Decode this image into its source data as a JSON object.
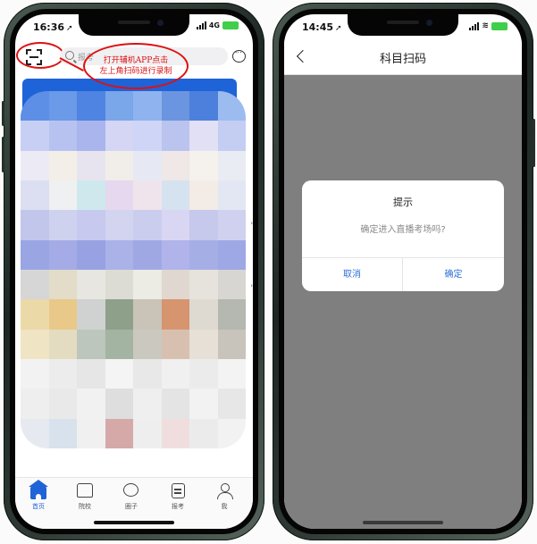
{
  "left_phone": {
    "status": {
      "time": "16:36",
      "network": "4G"
    },
    "search": {
      "placeholder": "报考"
    },
    "annotation": {
      "line1": "打开辅机APP点击",
      "line2": "左上角扫码进行录制"
    },
    "tabs": [
      {
        "label": "首页",
        "icon": "home-icon",
        "active": true
      },
      {
        "label": "院校",
        "icon": "college-icon",
        "active": false
      },
      {
        "label": "圈子",
        "icon": "chat-bubble-icon",
        "active": false
      },
      {
        "label": "报考",
        "icon": "document-icon",
        "active": false
      },
      {
        "label": "我",
        "icon": "user-icon",
        "active": false
      }
    ],
    "colors": {
      "accent": "#1f63d8",
      "annotation_red": "#d11111"
    }
  },
  "right_phone": {
    "status": {
      "time": "14:45"
    },
    "header": {
      "title": "科目扫码"
    },
    "dialog": {
      "title": "提示",
      "message": "确定进入直播考场吗?",
      "cancel_label": "取消",
      "confirm_label": "确定"
    },
    "colors": {
      "overlay": "#7f7f7f",
      "button_text": "#2f6fd6"
    }
  }
}
